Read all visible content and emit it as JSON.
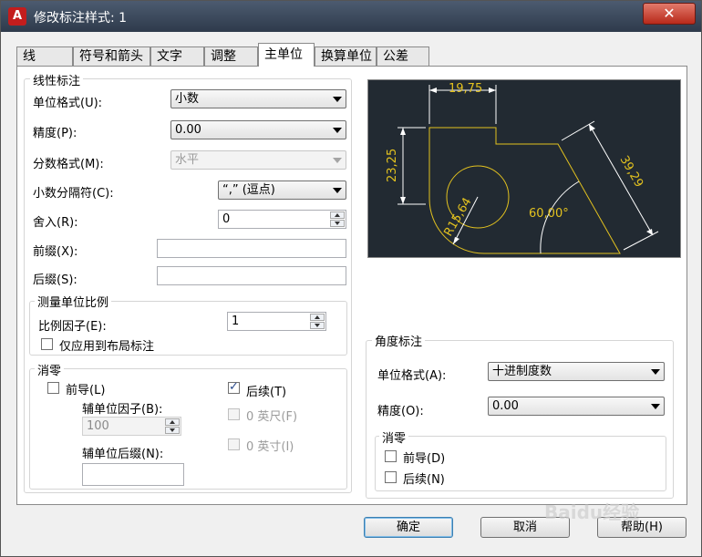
{
  "window": {
    "title": "修改标注样式: 1",
    "close": "✕"
  },
  "tabs": [
    "线",
    "符号和箭头",
    "文字",
    "调整",
    "主单位",
    "换算单位",
    "公差"
  ],
  "linear": {
    "legend": "线性标注",
    "unit_format_label": "单位格式(U):",
    "unit_format_value": "小数",
    "precision_label": "精度(P):",
    "precision_value": "0.00",
    "fraction_label": "分数格式(M):",
    "fraction_value": "水平",
    "decimal_sep_label": "小数分隔符(C):",
    "decimal_sep_value": "“,” (逗点)",
    "round_label": "舍入(R):",
    "round_value": "0",
    "prefix_label": "前缀(X):",
    "prefix_value": "",
    "suffix_label": "后缀(S):",
    "suffix_value": ""
  },
  "scale": {
    "legend": "测量单位比例",
    "factor_label": "比例因子(E):",
    "factor_value": "1",
    "layout_only_label": "仅应用到布局标注"
  },
  "zero": {
    "legend": "消零",
    "leading_label": "前导(L)",
    "trailing_label": "后续(T)",
    "sub_factor_label": "辅单位因子(B):",
    "sub_factor_value": "100",
    "feet_label": "0 英尺(F)",
    "inches_label": "0 英寸(I)",
    "sub_suffix_label": "辅单位后缀(N):",
    "sub_suffix_value": ""
  },
  "preview": {
    "dim_top": "19,75",
    "dim_left": "23,25",
    "dim_diag": "39,29",
    "dim_radius": "R15,64",
    "dim_angle": "60,00°",
    "line_color": "#e3c21f",
    "dim_color": "#ffffff",
    "bg": "#222a32"
  },
  "angular": {
    "legend": "角度标注",
    "unit_format_label": "单位格式(A):",
    "unit_format_value": "十进制度数",
    "precision_label": "精度(O):",
    "precision_value": "0.00",
    "zero_legend": "消零",
    "leading_label": "前导(D)",
    "trailing_label": "后续(N)"
  },
  "buttons": {
    "ok": "确定",
    "cancel": "取消",
    "help": "帮助(H)"
  },
  "watermark": "Baidu经验"
}
